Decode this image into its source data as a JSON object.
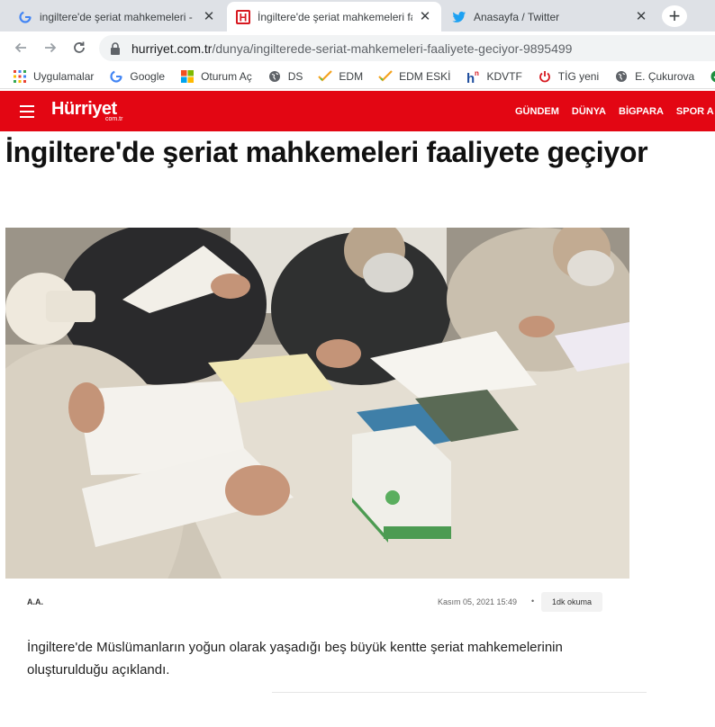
{
  "browser": {
    "tabs": [
      {
        "title": "ingiltere'de şeriat mahkemeleri -",
        "icon": "google-g-icon",
        "active": false
      },
      {
        "title": "İngiltere'de şeriat mahkemeleri fa",
        "icon": "hurriyet-h-icon",
        "active": true
      },
      {
        "title": "Anasayfa / Twitter",
        "icon": "twitter-bird-icon",
        "active": false
      }
    ],
    "close_glyph": "✕",
    "new_tab_glyph": "+",
    "url": {
      "domain": "hurriyet.com.tr",
      "path": "/dunya/ingilterede-seriat-mahkemeleri-faaliyete-geciyor-9895499"
    }
  },
  "bookmarks": [
    {
      "label": "Uygulamalar",
      "icon": "apps-grid-icon"
    },
    {
      "label": "Google",
      "icon": "google-g-icon"
    },
    {
      "label": "Oturum Aç",
      "icon": "microsoft-icon"
    },
    {
      "label": "DS",
      "icon": "globe-icon"
    },
    {
      "label": "EDM",
      "icon": "check-pencil-icon"
    },
    {
      "label": "EDM ESKİ",
      "icon": "check-pencil-icon"
    },
    {
      "label": "KDVTF",
      "icon": "hn-icon"
    },
    {
      "label": "TİG yeni",
      "icon": "power-icon"
    },
    {
      "label": "E. Çukurova",
      "icon": "globe-icon"
    }
  ],
  "site": {
    "logo": "Hürriyet",
    "logo_sub": "com.tr",
    "nav": [
      "GÜNDEM",
      "DÜNYA",
      "BİGPARA",
      "SPOR A"
    ],
    "brand_color": "#e30613"
  },
  "article": {
    "headline": "İngiltere'de şeriat mahkemeleri faaliyete geçiyor",
    "source": "A.A.",
    "date": "Kasım 05, 2021 15:49",
    "dot": "•",
    "read_time": "1dk okuma",
    "summary": "İngiltere'de Müslümanların yoğun olarak yaşadığı beş büyük kentte şeriat mahkemelerinin oluşturulduğu açıklandı."
  }
}
